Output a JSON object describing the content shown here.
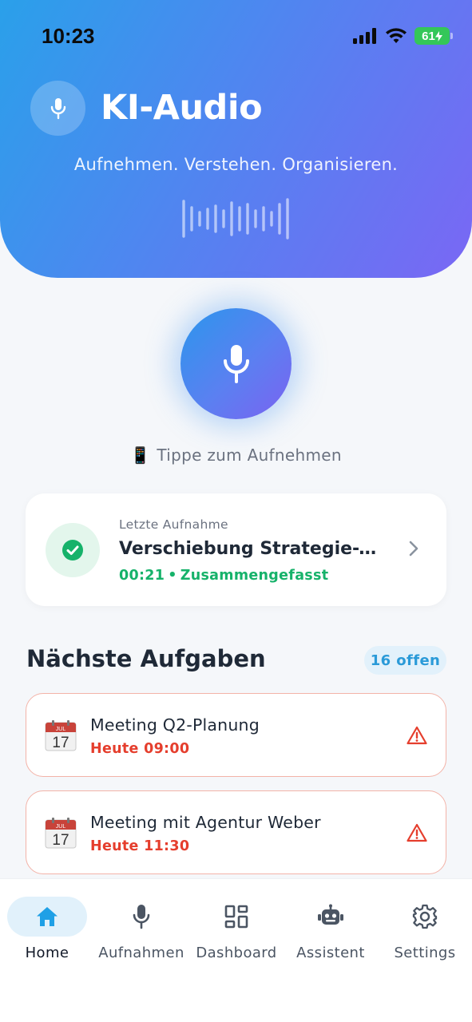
{
  "status_bar": {
    "time": "10:23",
    "battery": "61"
  },
  "header": {
    "title": "KI-Audio",
    "subtitle": "Aufnehmen. Verstehen. Organisieren.",
    "logo_icon": "mic-icon"
  },
  "record": {
    "button_icon": "mic-icon",
    "hint_emoji": "📱",
    "hint": "Tippe zum Aufnehmen"
  },
  "last_recording": {
    "label": "Letzte Aufnahme",
    "title": "Verschiebung Strategie-Workshop",
    "duration": "00:21",
    "separator": "•",
    "status": "Zusammengefasst",
    "status_color": "#16b26a"
  },
  "tasks_section": {
    "title": "Nächste Aufgaben",
    "badge": "16 offen",
    "items": [
      {
        "title": "Meeting Q2-Planung",
        "time": "Heute 09:00",
        "icon": "calendar-icon",
        "alert_icon": "warning-icon"
      },
      {
        "title": "Meeting mit Agentur Weber",
        "time": "Heute 11:30",
        "icon": "calendar-icon",
        "alert_icon": "warning-icon"
      }
    ]
  },
  "calendar_icon": {
    "month": "JUL",
    "day": "17"
  },
  "tabbar": {
    "active": "Home",
    "accent_color": "#1fa0e6",
    "tabs": [
      {
        "label": "Home",
        "icon": "home-icon"
      },
      {
        "label": "Aufnahmen",
        "icon": "mic-icon"
      },
      {
        "label": "Dashboard",
        "icon": "dashboard-icon"
      },
      {
        "label": "Assistent",
        "icon": "robot-icon"
      },
      {
        "label": "Settings",
        "icon": "gear-icon"
      }
    ]
  }
}
